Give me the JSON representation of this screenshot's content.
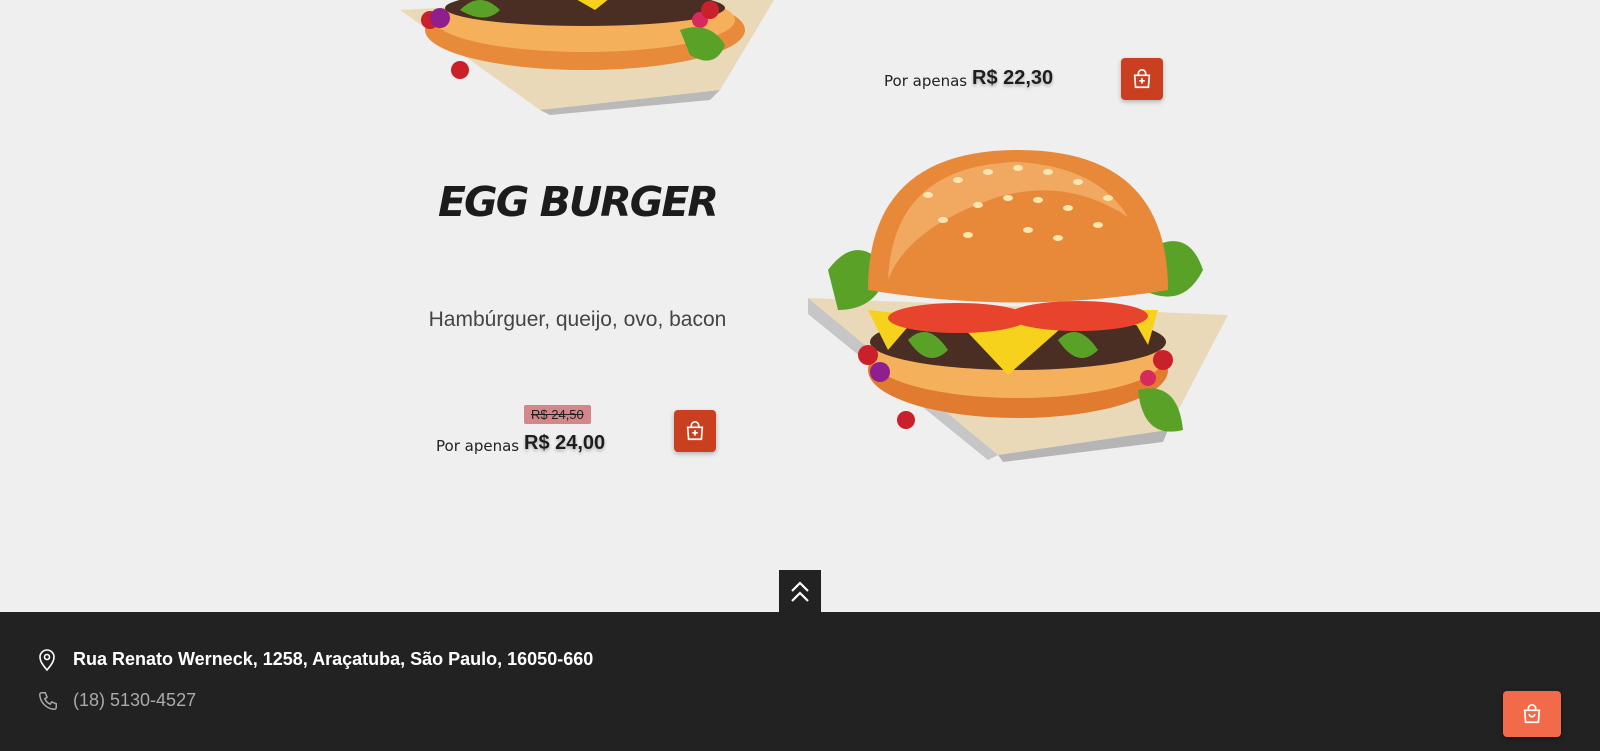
{
  "top_item": {
    "price_prefix": "Por apenas",
    "price": "R$ 22,30"
  },
  "egg_burger": {
    "name": "Egg Burger",
    "description": "Hambúrguer, queijo, ovo, bacon",
    "price_prefix": "Por apenas",
    "old_price": "R$ 24,50",
    "price": "R$ 24,00"
  },
  "footer": {
    "address": "Rua Renato Werneck, 1258, Araçatuba, São Paulo, 16050-660",
    "phone": "(18) 5130-4527"
  },
  "icons": {
    "add_to_cart": "bag-plus-icon",
    "scroll_top": "double-chevron-up-icon",
    "location": "map-pin-icon",
    "phone": "phone-icon",
    "cart": "shopping-bag-icon"
  },
  "colors": {
    "accent": "#c93f1f",
    "cart_float": "#f26a4a",
    "footer_bg": "#222222",
    "page_bg": "#efefef",
    "old_price_bg": "#d4878b"
  }
}
